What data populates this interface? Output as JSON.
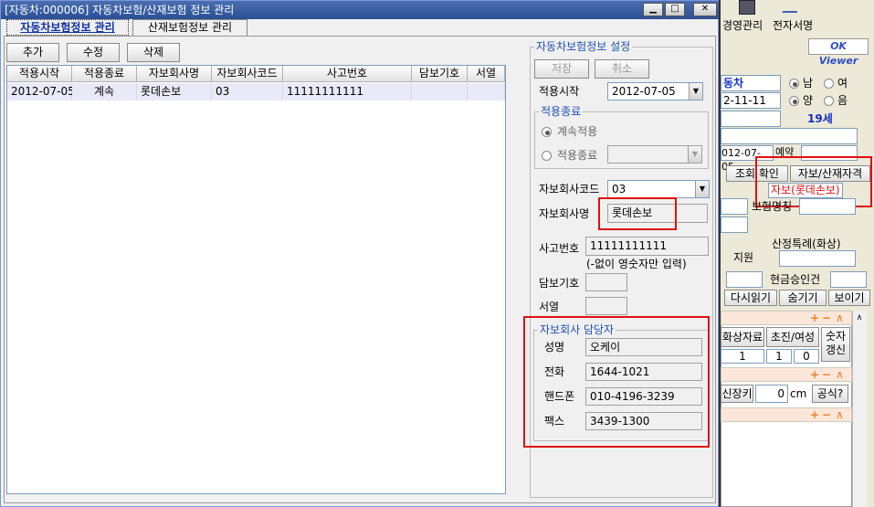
{
  "window": {
    "title": "[자동차:000006] 자동차보험/산재보험 정보 관리",
    "minimize_glyph": "▁",
    "maximize_glyph": "□",
    "close_glyph": "✕"
  },
  "tabs": [
    {
      "label": "자동차보험정보 관리",
      "active": true
    },
    {
      "label": "산재보험정보 관리",
      "active": false
    }
  ],
  "toolbar": {
    "add": "추가",
    "edit": "수정",
    "delete": "삭제"
  },
  "grid": {
    "columns": [
      "적용시작",
      "적용종료",
      "자보회사명",
      "자보회사코드",
      "사고번호",
      "담보기호",
      "서열"
    ],
    "rows": [
      [
        "2012-07-05",
        "계속",
        "롯데손보",
        "03",
        "11111111111",
        "",
        ""
      ]
    ]
  },
  "form": {
    "group_title": "자동차보험정보 설정",
    "save": "저장",
    "cancel": "취소",
    "start_label": "적용시작",
    "start_value": "2012-07-05",
    "end_group_title": "적용종료",
    "continue_label": "계속적용",
    "end_label": "적용종료",
    "company_code_label": "자보회사코드",
    "company_code_value": "03",
    "company_name_label": "자보회사명",
    "company_name_value": "롯데손보",
    "accident_label": "사고번호",
    "accident_value": "11111111111",
    "accident_hint": "(-없이 영숫자만 입력)",
    "guarantee_label": "담보기호",
    "order_label": "서열"
  },
  "contact": {
    "group_title": "자보회사 담당자",
    "name_label": "성명",
    "name_value": "오케이",
    "phone_label": "전화",
    "phone_value": "1644-1021",
    "mobile_label": "핸드폰",
    "mobile_value": "010-4196-3239",
    "fax_label": "팩스",
    "fax_value": "3439-1300"
  },
  "background_app": {
    "menu1": "경영관리",
    "menu2": "전자서명",
    "viewer": "OK Viewer",
    "field1": "동차",
    "male": "남",
    "female": "여",
    "date1": "2-11-11",
    "yang": "양",
    "eum": "음",
    "age": "19세",
    "date2": "012-07-05",
    "reserve": "예약",
    "confirm": "조회 확인",
    "insurance_btn": "자보/산재자격",
    "insurance_value": "자보(롯데손보)",
    "insurer": "보험명칭",
    "support": "지원",
    "special": "산정특례(화상)",
    "cash": "현금승인건",
    "reload": "다시읽기",
    "hide": "숨기기",
    "show": "보이기",
    "burn": "화상자료",
    "first": "초진/여성",
    "refresh": "숫자갱신",
    "n1": "1",
    "n2": "1",
    "n3": "0",
    "height_label": "신장키",
    "height_value": "0",
    "unit": "cm",
    "formula": "공식?",
    "plus": "+",
    "minus": "−",
    "up": "∧"
  },
  "colors": {
    "highlight": "#e01010",
    "group_title": "#2050b0",
    "title_bar": "#2a4f95"
  }
}
